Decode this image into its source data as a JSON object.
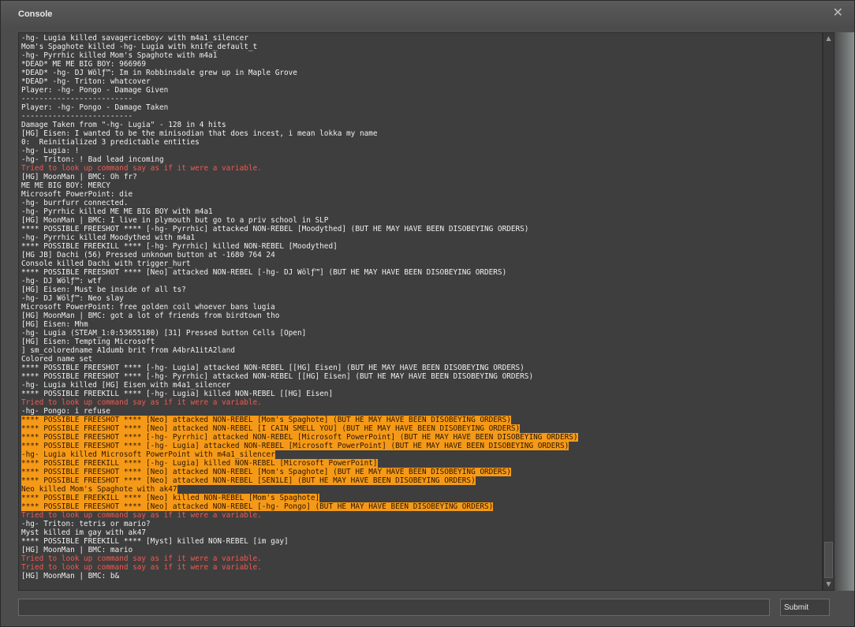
{
  "window": {
    "title": "Console",
    "close_icon": "close-icon"
  },
  "colors": {
    "normal": "#f0f0f0",
    "error": "#f05a50",
    "highlight": "#f59a18"
  },
  "log": [
    {
      "text": "-hg- Lugia killed savagericeboy✓ with m4a1_silencer",
      "style": "normal"
    },
    {
      "text": "Mom's Spaghote killed -hg- Lugia with knife_default_t",
      "style": "normal"
    },
    {
      "text": "-hg- Pyrrhic killed Mom's Spaghote with m4a1",
      "style": "normal"
    },
    {
      "text": "*DEAD* ME ME BIG BOY: 966969",
      "style": "normal"
    },
    {
      "text": "*DEAD* -hg- DJ Wölƒ™: Im in Robbinsdale grew up in Maple Grove",
      "style": "normal"
    },
    {
      "text": "*DEAD* -hg- Triton: whatcover",
      "style": "normal"
    },
    {
      "text": "Player: -hg- Pongo - Damage Given",
      "style": "normal"
    },
    {
      "text": "-------------------------",
      "style": "normal"
    },
    {
      "text": "Player: -hg- Pongo - Damage Taken",
      "style": "normal"
    },
    {
      "text": "-------------------------",
      "style": "normal"
    },
    {
      "text": "Damage Taken from \"-hg- Lugia\" - 128 in 4 hits",
      "style": "normal"
    },
    {
      "text": "[HG] Eisen: I wanted to be the minisodian that does incest, i mean lokka my name",
      "style": "normal"
    },
    {
      "text": "0:  Reinitialized 3 predictable entities",
      "style": "normal"
    },
    {
      "text": "-hg- Lugia: !",
      "style": "normal"
    },
    {
      "text": "-hg- Triton: ! Bad lead incoming",
      "style": "normal"
    },
    {
      "text": "Tried to look up command say as if it were a variable.",
      "style": "error"
    },
    {
      "text": "[HG] MoonMan | BMC: Oh fr?",
      "style": "normal"
    },
    {
      "text": "ME ME BIG BOY: MERCY",
      "style": "normal"
    },
    {
      "text": "Microsoft PowerPoint: die",
      "style": "normal"
    },
    {
      "text": "-hg- burrfurr connected.",
      "style": "normal"
    },
    {
      "text": "-hg- Pyrrhic killed ME ME BIG BOY with m4a1",
      "style": "normal"
    },
    {
      "text": "[HG] MoonMan | BMC: I live in plymouth but go to a priv school in SLP",
      "style": "normal"
    },
    {
      "text": "**** POSSIBLE FREESHOT **** [-hg- Pyrrhic] attacked NON-REBEL [Moodythed] (BUT HE MAY HAVE BEEN DISOBEYING ORDERS)",
      "style": "normal"
    },
    {
      "text": "-hg- Pyrrhic killed Moodythed with m4a1",
      "style": "normal"
    },
    {
      "text": "**** POSSIBLE FREEKILL **** [-hg- Pyrrhic] killed NON-REBEL [Moodythed]",
      "style": "normal"
    },
    {
      "text": "[HG JB] Dachi (56) Pressed unknown button at -1680 764 24",
      "style": "normal"
    },
    {
      "text": "Console killed Dachi with trigger_hurt",
      "style": "normal"
    },
    {
      "text": "**** POSSIBLE FREESHOT **** [Neo] attacked NON-REBEL [-hg- DJ Wölƒ™] (BUT HE MAY HAVE BEEN DISOBEYING ORDERS)",
      "style": "normal"
    },
    {
      "text": "-hg- DJ Wölƒ™: wtf",
      "style": "normal"
    },
    {
      "text": "[HG] Eisen: Must be inside of all ts?",
      "style": "normal"
    },
    {
      "text": "-hg- DJ Wölƒ™: Neo slay",
      "style": "normal"
    },
    {
      "text": "Microsoft PowerPoint: free golden coil whoever bans lugia",
      "style": "normal"
    },
    {
      "text": "[HG] MoonMan | BMC: got a lot of friends from birdtown tho",
      "style": "normal"
    },
    {
      "text": "[HG] Eisen: Mhm",
      "style": "normal"
    },
    {
      "text": "-hg- Lugia (STEAM_1:0:53655180) [31] Pressed button Cells [Open]",
      "style": "normal"
    },
    {
      "text": "[HG] Eisen: Tempting Microsoft",
      "style": "normal"
    },
    {
      "text": "] sm_coloredname A1dumb brit from A4brA1itA2land",
      "style": "normal"
    },
    {
      "text": "Colored name set",
      "style": "normal"
    },
    {
      "text": "**** POSSIBLE FREESHOT **** [-hg- Lugia] attacked NON-REBEL [[HG] Eisen] (BUT HE MAY HAVE BEEN DISOBEYING ORDERS)",
      "style": "normal"
    },
    {
      "text": "**** POSSIBLE FREESHOT **** [-hg- Pyrrhic] attacked NON-REBEL [[HG] Eisen] (BUT HE MAY HAVE BEEN DISOBEYING ORDERS)",
      "style": "normal"
    },
    {
      "text": "-hg- Lugia killed [HG] Eisen with m4a1_silencer",
      "style": "normal"
    },
    {
      "text": "**** POSSIBLE FREEKILL **** [-hg- Lugia] killed NON-REBEL [[HG] Eisen]",
      "style": "normal"
    },
    {
      "text": "Tried to look up command say as if it were a variable.",
      "style": "error"
    },
    {
      "text": "-hg- Pongo: i refuse",
      "style": "normal"
    },
    {
      "text": "**** POSSIBLE FREESHOT **** [Neo] attacked NON-REBEL [Mom's Spaghote] (BUT HE MAY HAVE BEEN DISOBEYING ORDERS)",
      "style": "highlight"
    },
    {
      "text": "**** POSSIBLE FREESHOT **** [Neo] attacked NON-REBEL [I CAIN SMELL YOU] (BUT HE MAY HAVE BEEN DISOBEYING ORDERS)",
      "style": "highlight"
    },
    {
      "text": "**** POSSIBLE FREESHOT **** [-hg- Pyrrhic] attacked NON-REBEL [Microsoft PowerPoint] (BUT HE MAY HAVE BEEN DISOBEYING ORDERS)",
      "style": "highlight"
    },
    {
      "text": "**** POSSIBLE FREESHOT **** [-hg- Lugia] attacked NON-REBEL [Microsoft PowerPoint] (BUT HE MAY HAVE BEEN DISOBEYING ORDERS)",
      "style": "highlight"
    },
    {
      "text": "-hg- Lugia killed Microsoft PowerPoint with m4a1_silencer",
      "style": "highlight"
    },
    {
      "text": "**** POSSIBLE FREEKILL **** [-hg- Lugia] killed NON-REBEL [Microsoft PowerPoint]",
      "style": "highlight"
    },
    {
      "text": "**** POSSIBLE FREESHOT **** [Neo] attacked NON-REBEL [Mom's Spaghote] (BUT HE MAY HAVE BEEN DISOBEYING ORDERS)",
      "style": "highlight"
    },
    {
      "text": "**** POSSIBLE FREESHOT **** [Neo] attacked NON-REBEL [SEN1LE] (BUT HE MAY HAVE BEEN DISOBEYING ORDERS)",
      "style": "highlight"
    },
    {
      "text": "Neo killed Mom's Spaghote with ak47",
      "style": "highlight"
    },
    {
      "text": "**** POSSIBLE FREEKILL **** [Neo] killed NON-REBEL [Mom's Spaghote]",
      "style": "highlight"
    },
    {
      "text": "**** POSSIBLE FREESHOT **** [Neo] attacked NON-REBEL [-hg- Pongo] (BUT HE MAY HAVE BEEN DISOBEYING ORDERS)",
      "style": "highlight"
    },
    {
      "text": "Tried to look up command say as if it were a variable.",
      "style": "error"
    },
    {
      "text": "-hg- Triton: tetris or mario?",
      "style": "normal"
    },
    {
      "text": "Myst killed im gay with ak47",
      "style": "normal"
    },
    {
      "text": "**** POSSIBLE FREEKILL **** [Myst] killed NON-REBEL [im gay]",
      "style": "normal"
    },
    {
      "text": "[HG] MoonMan | BMC: mario",
      "style": "normal"
    },
    {
      "text": "Tried to look up command say as if it were a variable.",
      "style": "error"
    },
    {
      "text": "Tried to look up command say as if it were a variable.",
      "style": "error"
    },
    {
      "text": "[HG] MoonMan | BMC: b&",
      "style": "normal"
    }
  ],
  "scrollbar": {
    "up_icon": "scroll-up-arrow-icon",
    "down_icon": "scroll-down-arrow-icon",
    "up_glyph": "▲",
    "down_glyph": "▼"
  },
  "command": {
    "value": "",
    "placeholder": ""
  },
  "submit_label": "Submit"
}
